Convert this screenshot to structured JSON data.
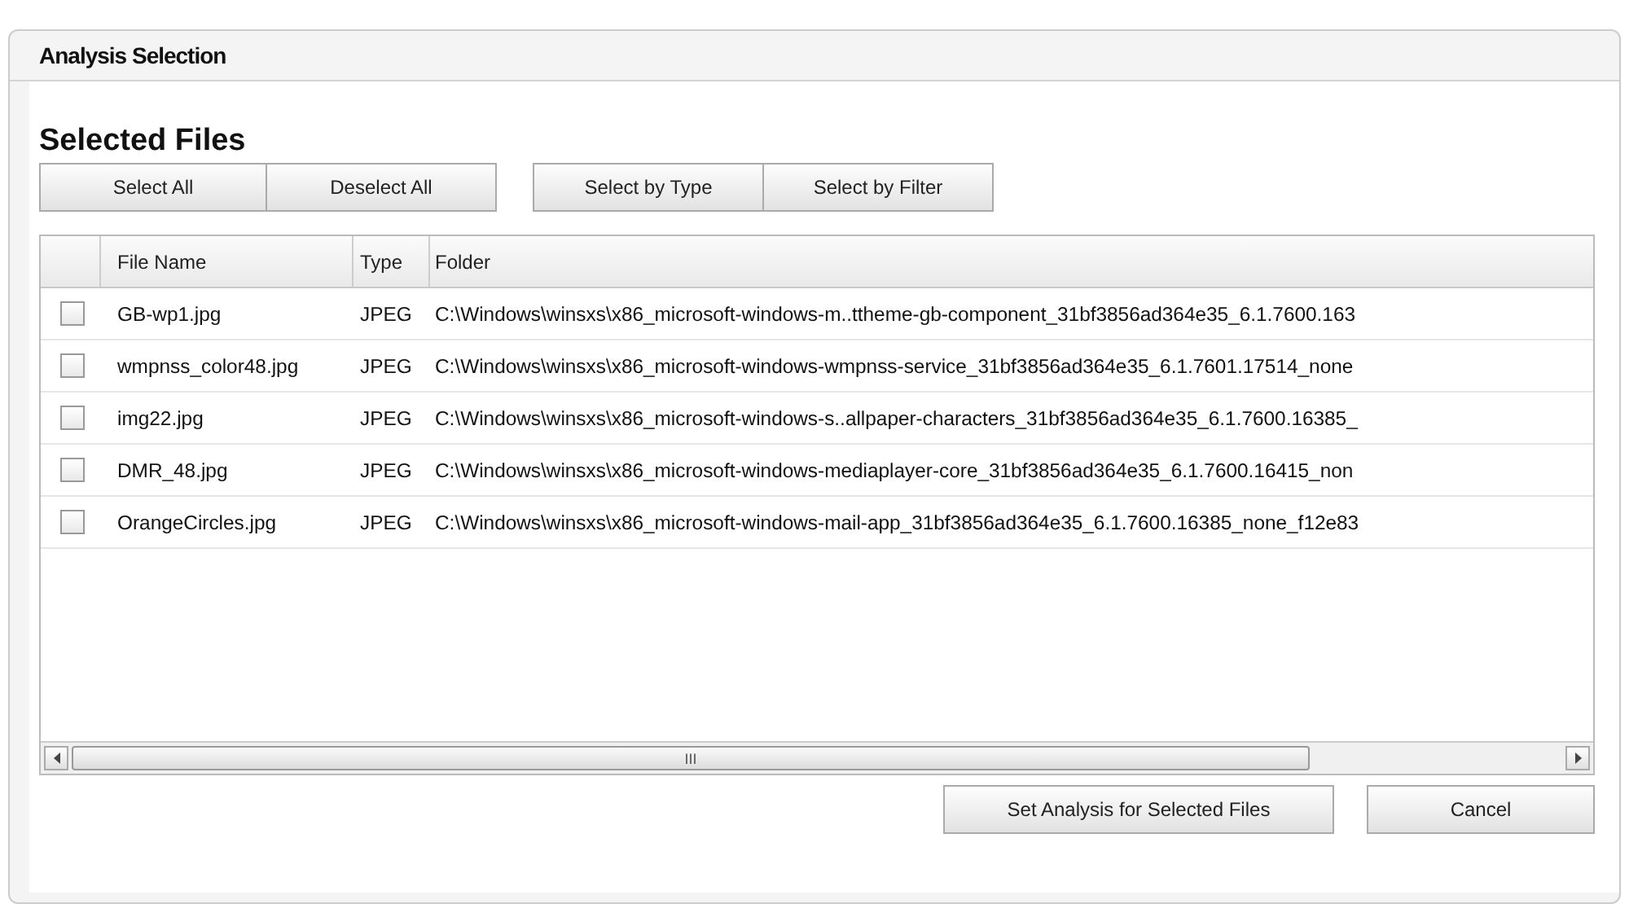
{
  "window": {
    "title": "Analysis Selection"
  },
  "heading": "Selected Files",
  "button_groups": [
    [
      "Select All",
      "Deselect All"
    ],
    [
      "Select by Type",
      "Select by Filter"
    ]
  ],
  "table": {
    "columns": [
      "File Name",
      "Type",
      "Folder"
    ],
    "rows": [
      {
        "checked": false,
        "cells": [
          "GB-wp1.jpg",
          "JPEG",
          "C:\\Windows\\winsxs\\x86_microsoft-windows-m..ttheme-gb-component_31bf3856ad364e35_6.1.7600.163"
        ]
      },
      {
        "checked": false,
        "cells": [
          "wmpnss_color48.jpg",
          "JPEG",
          "C:\\Windows\\winsxs\\x86_microsoft-windows-wmpnss-service_31bf3856ad364e35_6.1.7601.17514_none"
        ]
      },
      {
        "checked": false,
        "cells": [
          "img22.jpg",
          "JPEG",
          "C:\\Windows\\winsxs\\x86_microsoft-windows-s..allpaper-characters_31bf3856ad364e35_6.1.7600.16385_"
        ]
      },
      {
        "checked": false,
        "cells": [
          "DMR_48.jpg",
          "JPEG",
          "C:\\Windows\\winsxs\\x86_microsoft-windows-mediaplayer-core_31bf3856ad364e35_6.1.7600.16415_non"
        ]
      },
      {
        "checked": false,
        "cells": [
          "OrangeCircles.jpg",
          "JPEG",
          "C:\\Windows\\winsxs\\x86_microsoft-windows-mail-app_31bf3856ad364e35_6.1.7600.16385_none_f12e83"
        ]
      }
    ],
    "scrollbar_grip": "III"
  },
  "footer_buttons": [
    "Set Analysis for Selected Files",
    "Cancel"
  ]
}
